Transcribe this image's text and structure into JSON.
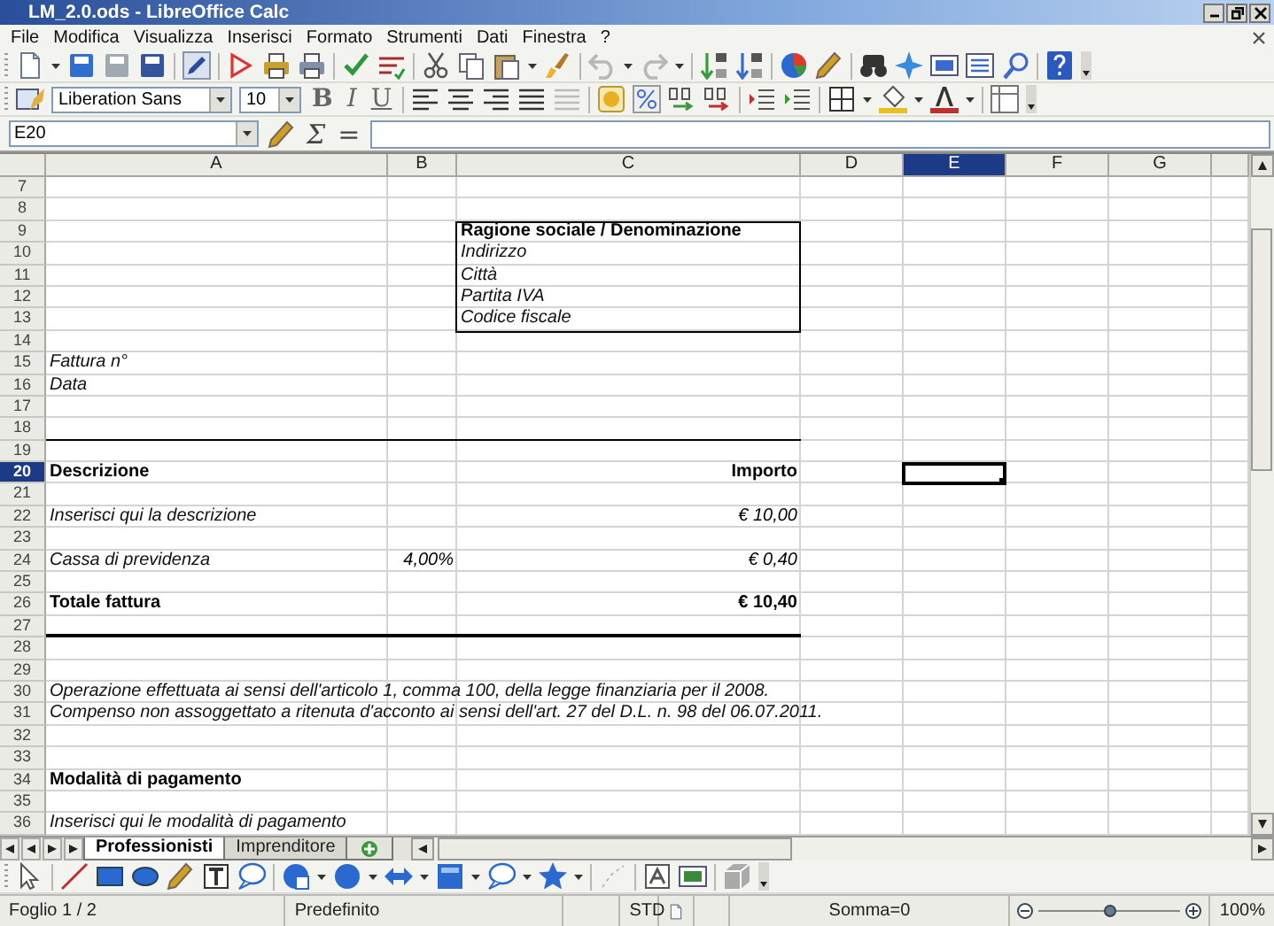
{
  "window": {
    "title": "LM_2.0.ods - LibreOffice Calc"
  },
  "menu": [
    "File",
    "Modifica",
    "Visualizza",
    "Inserisci",
    "Formato",
    "Strumenti",
    "Dati",
    "Finestra",
    "?"
  ],
  "formatting": {
    "font_name": "Liberation Sans",
    "font_size": "10",
    "style_buttons": [
      {
        "label": "B",
        "kind": "bold"
      },
      {
        "label": "I",
        "kind": "italic"
      },
      {
        "label": "U",
        "kind": "underline"
      }
    ]
  },
  "formula_bar": {
    "cell_reference": "E20",
    "buttons": [
      "Σ",
      "="
    ]
  },
  "sheet": {
    "columns": [
      {
        "label": "A",
        "selected": false
      },
      {
        "label": "B",
        "selected": false
      },
      {
        "label": "C",
        "selected": false
      },
      {
        "label": "D",
        "selected": false
      },
      {
        "label": "E",
        "selected": true
      },
      {
        "label": "F",
        "selected": false
      },
      {
        "label": "G",
        "selected": false
      }
    ],
    "rows": [
      {
        "number": "7",
        "selected": false
      },
      {
        "number": "8",
        "selected": false
      },
      {
        "number": "9",
        "selected": false,
        "cells": [
          {
            "kind": "empty"
          },
          {
            "kind": "empty"
          },
          {
            "kind": "heading",
            "text": "Ragione sociale / Denominazione",
            "boxed": true
          }
        ]
      },
      {
        "number": "10",
        "selected": false,
        "cells": [
          {
            "kind": "empty"
          },
          {
            "kind": "empty"
          },
          {
            "kind": "note",
            "text": "Indirizzo",
            "boxed": true
          }
        ]
      },
      {
        "number": "11",
        "selected": false,
        "cells": [
          {
            "kind": "empty"
          },
          {
            "kind": "empty"
          },
          {
            "kind": "note",
            "text": "Città",
            "boxed": true
          }
        ]
      },
      {
        "number": "12",
        "selected": false,
        "cells": [
          {
            "kind": "empty"
          },
          {
            "kind": "empty"
          },
          {
            "kind": "note",
            "text": "Partita IVA",
            "boxed": true
          }
        ]
      },
      {
        "number": "13",
        "selected": false,
        "cells": [
          {
            "kind": "empty"
          },
          {
            "kind": "empty"
          },
          {
            "kind": "note",
            "text": "Codice fiscale",
            "boxed": true
          }
        ]
      },
      {
        "number": "14",
        "selected": false
      },
      {
        "number": "15",
        "selected": false,
        "cells": [
          {
            "kind": "note",
            "text": "Fattura n°"
          }
        ]
      },
      {
        "number": "16",
        "selected": false,
        "cells": [
          {
            "kind": "note",
            "text": "Data"
          }
        ]
      },
      {
        "number": "17",
        "selected": false
      },
      {
        "number": "18",
        "selected": false,
        "rule": {
          "kind": "thin"
        }
      },
      {
        "number": "19",
        "selected": false
      },
      {
        "number": "20",
        "selected": true,
        "cells": [
          {
            "kind": "heading",
            "text": "Descrizione"
          },
          {
            "kind": "empty"
          },
          {
            "kind": "total",
            "text": "Importo"
          }
        ]
      },
      {
        "number": "21",
        "selected": false
      },
      {
        "number": "22",
        "selected": false,
        "cells": [
          {
            "kind": "note",
            "text": "Inserisci qui la descrizione"
          },
          {
            "kind": "empty"
          },
          {
            "kind": "amount",
            "text": "€ 10,00"
          }
        ]
      },
      {
        "number": "23",
        "selected": false
      },
      {
        "number": "24",
        "selected": false,
        "cells": [
          {
            "kind": "note",
            "text": "Cassa di previdenza"
          },
          {
            "kind": "amount",
            "text": "4,00%"
          },
          {
            "kind": "amount",
            "text": "€ 0,40"
          }
        ]
      },
      {
        "number": "25",
        "selected": false
      },
      {
        "number": "26",
        "selected": false,
        "cells": [
          {
            "kind": "heading",
            "text": "Totale fattura"
          },
          {
            "kind": "empty"
          },
          {
            "kind": "total",
            "text": "€ 10,40"
          }
        ]
      },
      {
        "number": "27",
        "selected": false,
        "rule": {
          "kind": "thick"
        }
      },
      {
        "number": "28",
        "selected": false
      },
      {
        "number": "29",
        "selected": false
      },
      {
        "number": "30",
        "selected": false,
        "cells": [
          {
            "kind": "note",
            "text": "Operazione effettuata ai sensi dell'articolo 1, comma 100, della legge finanziaria per il 2008."
          }
        ]
      },
      {
        "number": "31",
        "selected": false,
        "cells": [
          {
            "kind": "note",
            "text": "Compenso non assoggettato a ritenuta d'acconto ai sensi dell'art. 27 del D.L. n. 98 del 06.07.2011."
          }
        ]
      },
      {
        "number": "32",
        "selected": false
      },
      {
        "number": "33",
        "selected": false
      },
      {
        "number": "34",
        "selected": false,
        "cells": [
          {
            "kind": "heading",
            "text": "Modalità di pagamento"
          }
        ]
      },
      {
        "number": "35",
        "selected": false
      },
      {
        "number": "36",
        "selected": false,
        "cells": [
          {
            "kind": "note",
            "text": "Inserisci qui le modalità di pagamento"
          }
        ]
      }
    ]
  },
  "sheet_tabs": [
    {
      "label": "Professionisti",
      "selected": true
    },
    {
      "label": "Imprenditore",
      "selected": false
    }
  ],
  "status_bar": {
    "sheet": "Foglio 1 / 2",
    "page_style": "Predefinito",
    "mode": "STD",
    "sum": "Somma=0",
    "zoom": {
      "level": 0.5,
      "reading": "100%"
    }
  }
}
